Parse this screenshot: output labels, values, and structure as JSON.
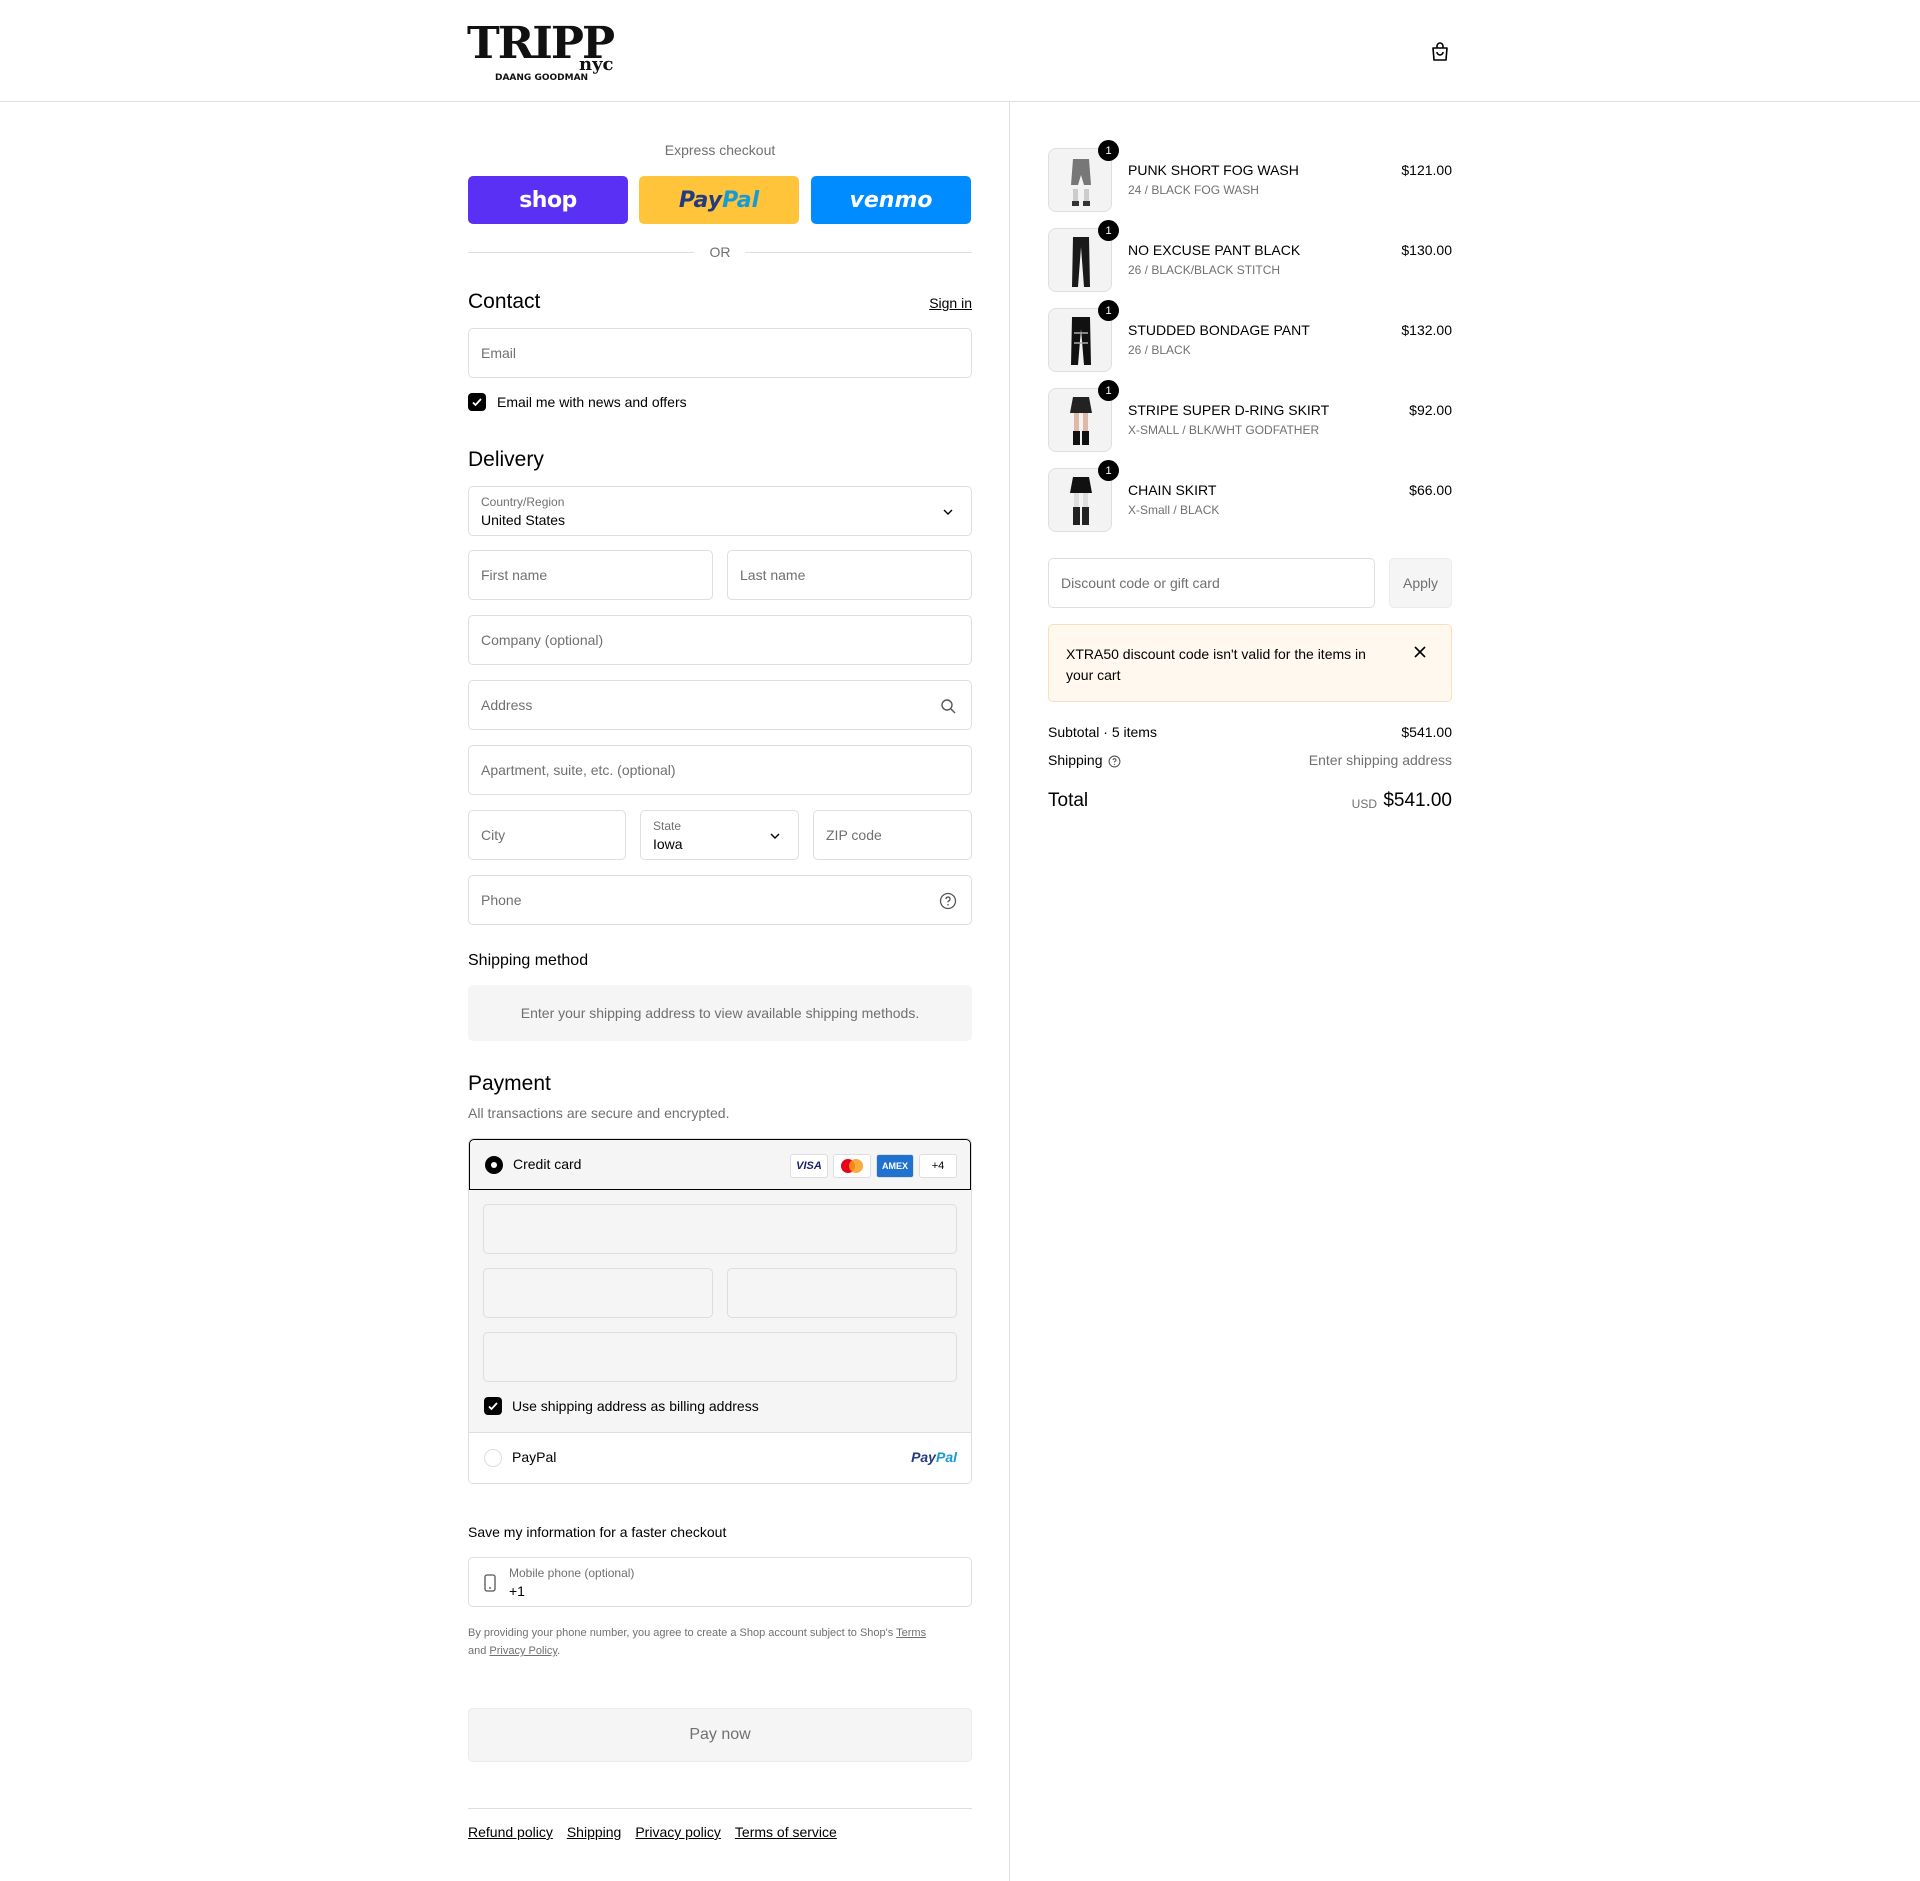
{
  "header": {
    "logo_text": "TRIPP nyc",
    "logo_sub": "DAANG GOODMAN",
    "cart_icon": "shopping-bag-icon"
  },
  "express": {
    "title": "Express checkout",
    "shop_label": "shop",
    "paypal_label_1": "Pay",
    "paypal_label_2": "Pal",
    "venmo_label": "venmo",
    "or_label": "OR"
  },
  "contact": {
    "title": "Contact",
    "sign_in": "Sign in",
    "email_placeholder": "Email",
    "newsletter_label": "Email me with news and offers",
    "newsletter_checked": true
  },
  "delivery": {
    "title": "Delivery",
    "country_label": "Country/Region",
    "country_value": "United States",
    "first_name_placeholder": "First name",
    "last_name_placeholder": "Last name",
    "company_placeholder": "Company (optional)",
    "address_placeholder": "Address",
    "apartment_placeholder": "Apartment, suite, etc. (optional)",
    "city_placeholder": "City",
    "state_label": "State",
    "state_value": "Iowa",
    "zip_placeholder": "ZIP code",
    "phone_placeholder": "Phone"
  },
  "shipping_method": {
    "title": "Shipping method",
    "message": "Enter your shipping address to view available shipping methods."
  },
  "payment": {
    "title": "Payment",
    "subtitle": "All transactions are secure and encrypted.",
    "credit_card_label": "Credit card",
    "card_brands": [
      "VISA",
      "MC",
      "AMEX",
      "+4"
    ],
    "billing_same_label": "Use shipping address as billing address",
    "paypal_option_label": "PayPal",
    "paypal_logo_1": "Pay",
    "paypal_logo_2": "Pal"
  },
  "save_info": {
    "title": "Save my information for a faster checkout",
    "mobile_label": "Mobile phone (optional)",
    "mobile_value": "+1",
    "disclaimer_1": "By providing your phone number, you agree to create a Shop account subject to Shop's ",
    "terms_link": "Terms",
    "disclaimer_2": "and ",
    "privacy_link": "Privacy Policy",
    "disclaimer_3": "."
  },
  "pay_now_label": "Pay now",
  "footer": {
    "links": [
      "Refund policy",
      "Shipping",
      "Privacy policy",
      "Terms of service"
    ]
  },
  "cart": {
    "items": [
      {
        "name": "PUNK SHORT FOG WASH",
        "variant": "24 / BLACK FOG WASH",
        "price": "$121.00",
        "qty": "1"
      },
      {
        "name": "NO EXCUSE PANT BLACK",
        "variant": "26 / BLACK/BLACK STITCH",
        "price": "$130.00",
        "qty": "1"
      },
      {
        "name": "STUDDED BONDAGE PANT",
        "variant": "26 / BLACK",
        "price": "$132.00",
        "qty": "1"
      },
      {
        "name": "STRIPE SUPER D-RING SKIRT",
        "variant": "X-SMALL / BLK/WHT GODFATHER",
        "price": "$92.00",
        "qty": "1"
      },
      {
        "name": "CHAIN SKIRT",
        "variant": "X-Small / BLACK",
        "price": "$66.00",
        "qty": "1"
      }
    ],
    "discount_placeholder": "Discount code or gift card",
    "apply_label": "Apply",
    "discount_error": "XTRA50 discount code isn't valid for the items in your cart",
    "subtotal_label": "Subtotal · 5 items",
    "subtotal_value": "$541.00",
    "shipping_label": "Shipping",
    "shipping_value": "Enter shipping address",
    "total_label": "Total",
    "total_currency": "USD",
    "total_value": "$541.00"
  },
  "colors": {
    "shop": "#5a31f4",
    "paypal": "#ffc439",
    "venmo": "#008cff",
    "notice_bg": "#fff8ef"
  }
}
